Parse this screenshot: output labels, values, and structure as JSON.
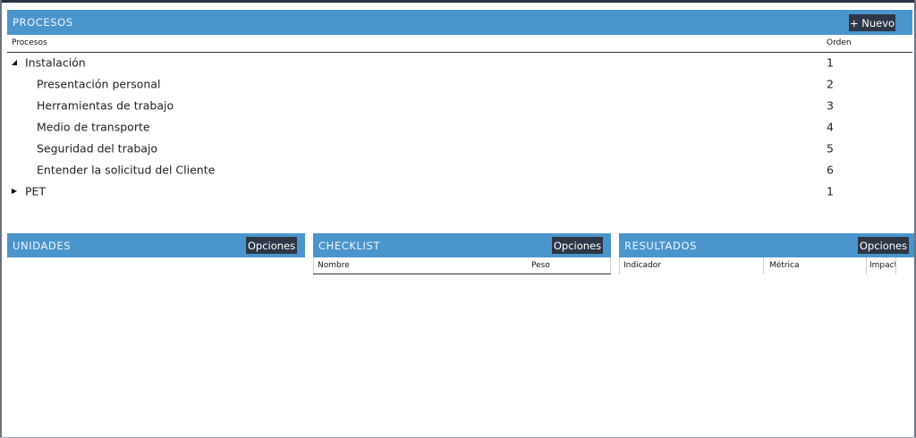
{
  "procesos": {
    "title": "PROCESOS",
    "new_button": "+ Nuevo",
    "columns": {
      "name": "Procesos",
      "order": "Orden"
    },
    "rows": [
      {
        "label": "Instalación",
        "order": "1",
        "level": 0,
        "expander": "expanded-triangle-icon"
      },
      {
        "label": "Presentación personal",
        "order": "2",
        "level": 1
      },
      {
        "label": "Herramientas de trabajo",
        "order": "3",
        "level": 1
      },
      {
        "label": "Medio de transporte",
        "order": "4",
        "level": 1
      },
      {
        "label": "Seguridad del trabajo",
        "order": "5",
        "level": 1
      },
      {
        "label": "Entender la solicitud del Cliente",
        "order": "6",
        "level": 1
      },
      {
        "label": "PET",
        "order": "1",
        "level": 0,
        "expander": "collapsed-triangle-icon"
      }
    ]
  },
  "unidades": {
    "title": "UNIDADES",
    "options_button": "Opciones"
  },
  "checklist": {
    "title": "CHECKLIST",
    "options_button": "Opciones",
    "columns": {
      "name": "Nombre",
      "weight": "Peso"
    }
  },
  "resultados": {
    "title": "RESULTADOS",
    "options_button": "Opciones",
    "columns": {
      "indicator": "Indicador",
      "metric": "Métrica",
      "impact": "Impact"
    }
  },
  "colors": {
    "header_blue": "#4a95cc",
    "button_dark": "#2d3747"
  }
}
